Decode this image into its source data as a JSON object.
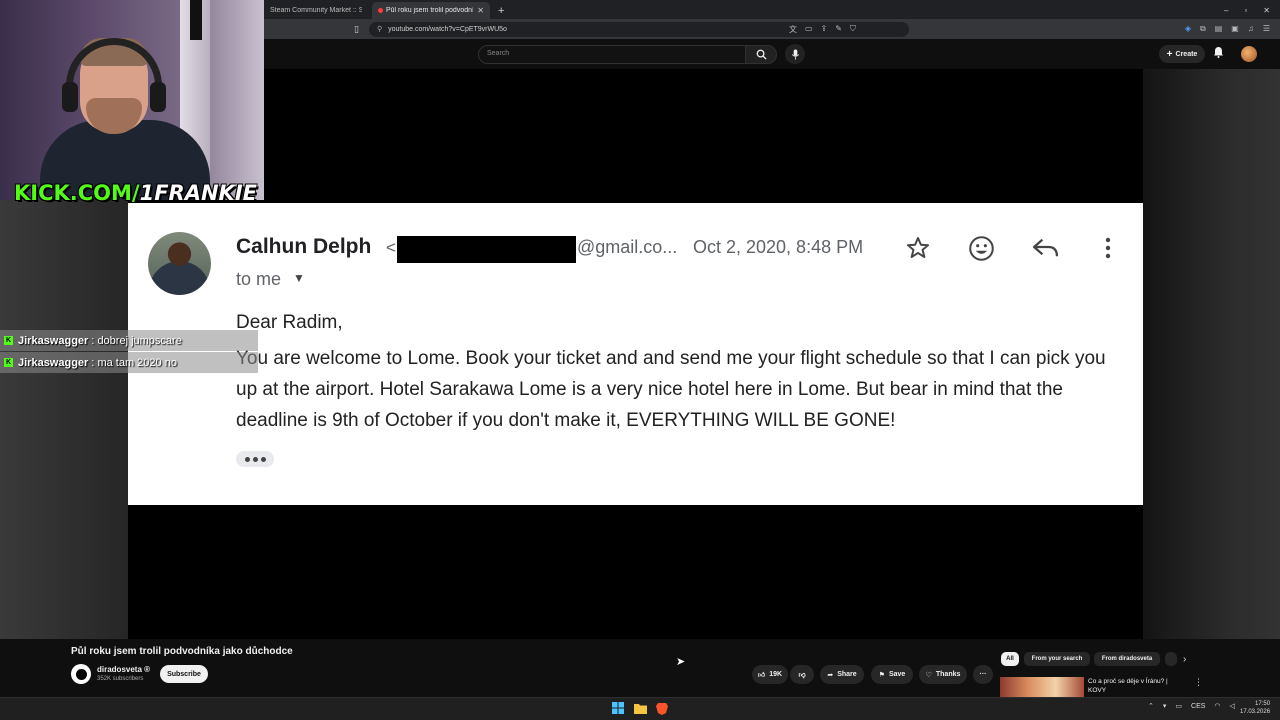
{
  "browser": {
    "tabs": [
      {
        "title": "Steam Community Market :: Showing"
      },
      {
        "title": "Půl roku jsem trolil podvodník"
      }
    ],
    "new_tab": "+",
    "window_controls": [
      "–",
      "▫",
      "✕"
    ],
    "url": "youtube.com/watch?v=CpET9vrWU5o"
  },
  "masthead": {
    "search_placeholder": "Search",
    "create_label": "Create"
  },
  "webcam_overlay": {
    "kick_prefix": "KICK.COM/",
    "kick_user": "1FRANKIE"
  },
  "email": {
    "sender_name": "Calhun Delph",
    "sender_lt": "<",
    "sender_domain": "@gmail.co...",
    "date": "Oct 2, 2020, 8:48 PM",
    "to": "to me",
    "greeting": "Dear Radim,",
    "body": "You are welcome to Lome. Book your ticket and and send me your flight schedule so that I can pick you up at the airport. Hotel Sarakawa Lome is a very nice hotel here in Lome. But bear in mind that the deadline is 9th of October if you don't make it, EVERYTHING WILL BE GONE!"
  },
  "chat": [
    {
      "user": "Jirkaswagger",
      "message": ": dobrej jumpscare"
    },
    {
      "user": "Jirkaswagger",
      "message": ": ma tam 2020 no"
    }
  ],
  "video": {
    "title": "Půl roku jsem trolil podvodníka jako důchodce",
    "channel": "diradosveta ®",
    "subscribers": "352K subscribers",
    "subscribe_label": "Subscribe",
    "likes": "19K",
    "share_label": "Share",
    "save_label": "Save",
    "thanks_label": "Thanks",
    "more_label": "···"
  },
  "recommendations": {
    "chips": [
      "All",
      "From your search",
      "From diradosveta"
    ],
    "first_title": "Co a proč se děje v Íránu? | KOVY"
  },
  "taskbar": {
    "tray_lang": "CES",
    "time": "17:50",
    "date": "17.03.2026"
  }
}
